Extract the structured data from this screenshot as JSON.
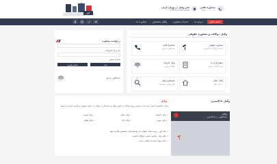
{
  "header": {
    "logo_caption": "افق",
    "contacts": [
      {
        "icon": "phone-icon",
        "line1": "مشاوره تلفنی",
        "line2": "۰۹۱۲-۰۰۰-۰۰۰۰"
      },
      {
        "icon": "location-icon",
        "line1": "دفتر وکیل در تهران، ایران",
        "line2": "+98 912 000 0000"
      }
    ]
  },
  "nav": {
    "links": [
      {
        "label": "صفحه اصلی",
        "active": true
      },
      {
        "label": "درباره ما"
      },
      {
        "label": "خدمات مشاوره"
      },
      {
        "label": "وکلای متخصص"
      },
      {
        "label": "تماس با ما"
      }
    ],
    "socials": [
      "facebook-icon",
      "instagram-icon",
      "twitter-icon",
      "telegram-icon"
    ]
  },
  "main": {
    "title": "وکیل ، وکالت و مشاوره حقوقی",
    "services": [
      {
        "title": "مشاوره حقوقی",
        "desc": "خدمات وکالت دادگستری",
        "icon": "gavel-icon"
      },
      {
        "title": "مشاوره تلفنی",
        "desc": "پاسخگویی سریع",
        "icon": "phone-icon"
      },
      {
        "title": "تنظیم قرارداد",
        "desc": "قراردادهای رسمی",
        "icon": "document-icon"
      },
      {
        "title": "وکیل خانواده",
        "desc": "طلاق و مهریه",
        "icon": "scale-icon"
      },
      {
        "title": "وکیل ملکی",
        "desc": "دعاوی ملکی",
        "icon": "home-icon"
      },
      {
        "title": "جستجوی وکیل",
        "desc": "یافتن وکیل متخصص",
        "icon": "search-icon"
      }
    ]
  },
  "side_form": {
    "heading": "درخواست مشاوره",
    "name_label": "نام و نام خانوادگی",
    "phone_label": "شماره تماس",
    "submit_label": "ثبت",
    "call_label": "تماس فوری",
    "note": "پاسخگویی سریع"
  },
  "article": {
    "title": "وکیل",
    "intro": "وکیل دادگستری کسی است که با داشتن پروانه وکالت از کانون وکلا، به نمایندگی از موکل در دعاوی حقوقی و کیفری حاضر می شود.",
    "items": [
      "وکیل خانواده",
      "وکیل ملکی",
      "وکیل کیفری",
      "وکیل مهریه",
      "وکیل چک",
      "وکیل طلاق"
    ],
    "notes": [
      "نکته اول : پرونده های حقوقی باید توسط وکیل متخصص پیگیری شود",
      "نکته دوم : مشاوره تلفنی با وکلای باتجربه",
      "نکته سوم : قرارداد وکالت رسمی"
    ]
  },
  "promo": {
    "title": "وکیل دادگستری",
    "line1": "وکالت",
    "line2": "پاسخگویی به دادگستری"
  }
}
